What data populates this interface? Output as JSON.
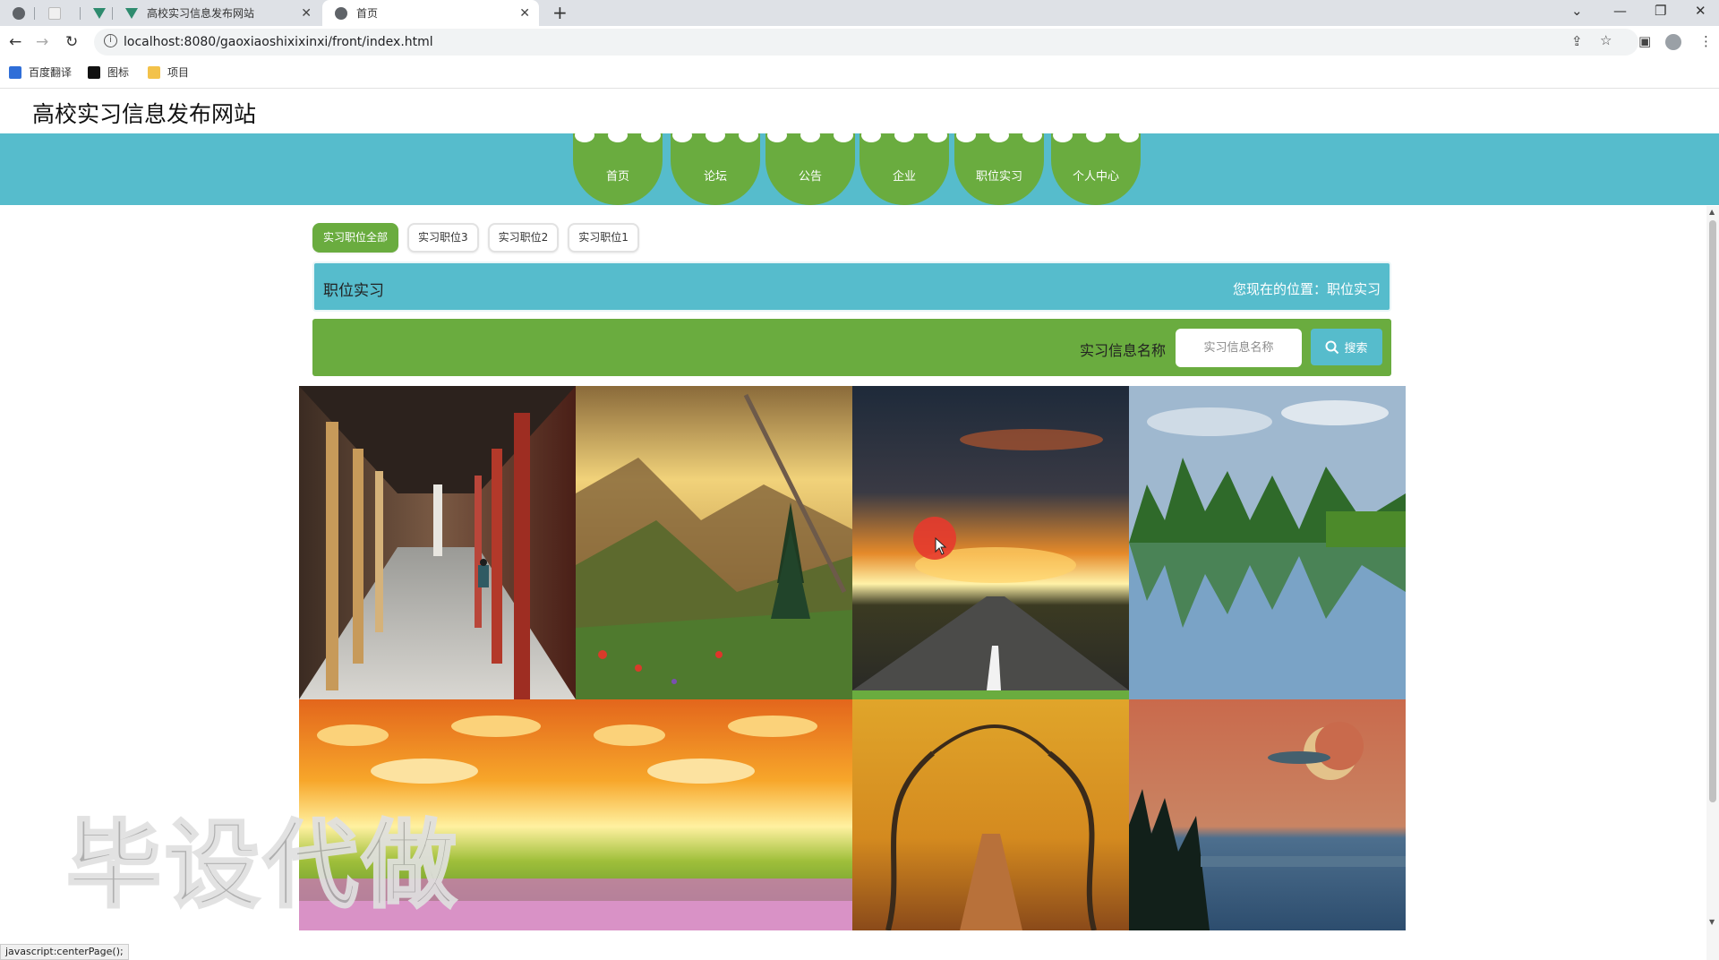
{
  "browser": {
    "tabs": [
      {
        "title": ""
      },
      {
        "title": ""
      },
      {
        "title": ""
      },
      {
        "title": "高校实习信息发布网站"
      },
      {
        "title": "首页"
      }
    ],
    "new_tab": "+",
    "url": "localhost:8080/gaoxiaoshixixinxi/front/index.html",
    "bookmarks": [
      {
        "label": "百度翻译",
        "color": "#2f6ed8"
      },
      {
        "label": "图标",
        "color": "#111111"
      },
      {
        "label": "项目",
        "color": "#f3c24a"
      }
    ],
    "status_text": "javascript:centerPage();"
  },
  "site": {
    "title": "高校实习信息发布网站",
    "nav": [
      "首页",
      "论坛",
      "公告",
      "企业",
      "职位实习",
      "个人中心"
    ]
  },
  "categories": [
    {
      "label": "实习职位全部",
      "active": true
    },
    {
      "label": "实习职位3",
      "active": false
    },
    {
      "label": "实习职位2",
      "active": false
    },
    {
      "label": "实习职位1",
      "active": false
    }
  ],
  "breadcrumb": {
    "title": "职位实习",
    "position": "您现在的位置：职位实习"
  },
  "search": {
    "label": "实习信息名称",
    "placeholder": "实习信息名称",
    "button": "搜索"
  },
  "gallery": [
    {
      "name": "corridor"
    },
    {
      "name": "mountain-valley"
    },
    {
      "name": "sunset-road"
    },
    {
      "name": "karst-lake"
    },
    {
      "name": "sunrise-meadow"
    },
    {
      "name": "sunrise-meadow"
    },
    {
      "name": "autumn-trees"
    },
    {
      "name": "moon-lake"
    }
  ],
  "watermark": "毕设代做",
  "colors": {
    "primary_teal": "#56bccc",
    "primary_green": "#6aac3f"
  }
}
